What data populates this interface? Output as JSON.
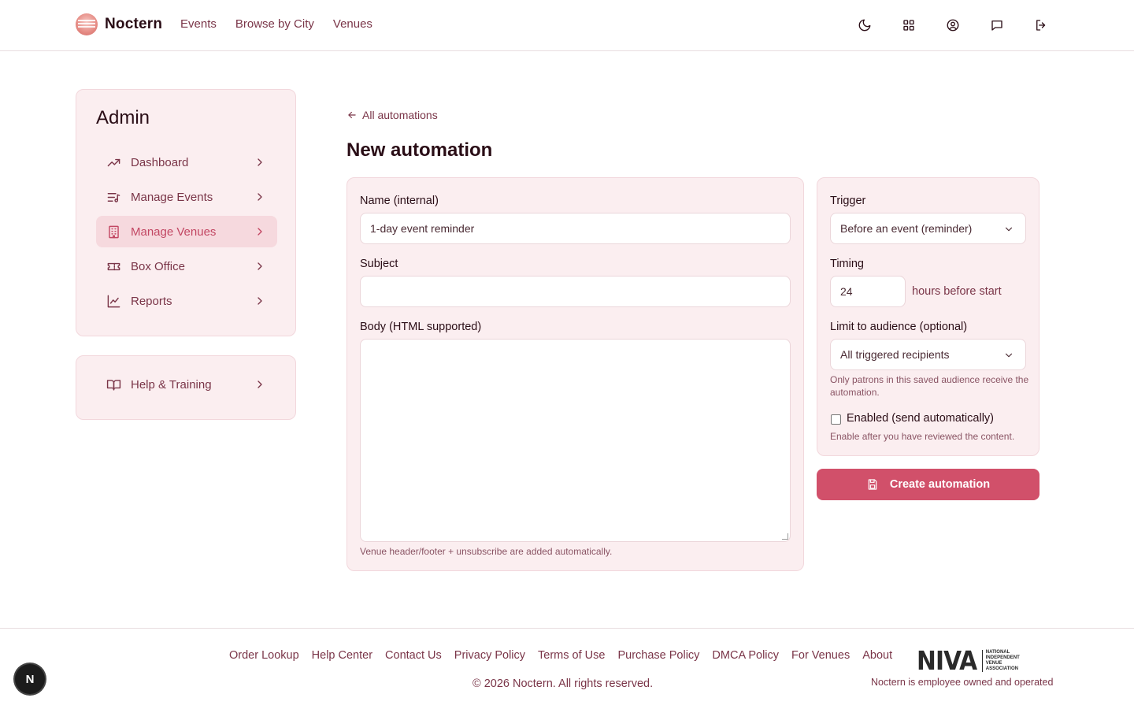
{
  "header": {
    "brand": "Noctern",
    "nav": [
      "Events",
      "Browse by City",
      "Venues"
    ],
    "icons": [
      "moon-icon",
      "grid-icon",
      "user-circle-icon",
      "message-icon",
      "logout-icon"
    ]
  },
  "sidebar": {
    "title": "Admin",
    "items": [
      {
        "label": "Dashboard",
        "icon": "trending-up-icon"
      },
      {
        "label": "Manage Events",
        "icon": "list-music-icon"
      },
      {
        "label": "Manage Venues",
        "icon": "building-icon",
        "active": true
      },
      {
        "label": "Box Office",
        "icon": "ticket-icon"
      },
      {
        "label": "Reports",
        "icon": "line-chart-icon"
      }
    ],
    "help": {
      "label": "Help & Training",
      "icon": "book-icon"
    }
  },
  "main": {
    "back_link": "All automations",
    "title": "New automation",
    "form": {
      "name_label": "Name (internal)",
      "name_value": "1-day event reminder",
      "subject_label": "Subject",
      "subject_value": "",
      "body_label": "Body (HTML supported)",
      "body_hint": "Venue header/footer + unsubscribe are added automatically."
    },
    "settings": {
      "trigger_label": "Trigger",
      "trigger_value": "Before an event (reminder)",
      "timing_label": "Timing",
      "timing_value": "24",
      "timing_suffix": "hours before start",
      "audience_label": "Limit to audience (optional)",
      "audience_value": "All triggered recipients",
      "audience_hint": "Only patrons in this saved audience receive the automation.",
      "enabled_label": "Enabled (send automatically)",
      "enabled_checked": false,
      "enabled_hint": "Enable after you have reviewed the content."
    },
    "create_button": "Create automation"
  },
  "footer": {
    "links": [
      "Order Lookup",
      "Help Center",
      "Contact Us",
      "Privacy Policy",
      "Terms of Use",
      "Purchase Policy",
      "DMCA Policy",
      "For Venues",
      "About"
    ],
    "copyright": "© 2026 Noctern. All rights reserved.",
    "niva_logo": "NIVA",
    "niva_lines": [
      "NATIONAL",
      "INDEPENDENT",
      "VENUE",
      "ASSOCIATION"
    ],
    "tagline": "Noctern is employee owned and operated"
  },
  "badge": "N",
  "colors": {
    "accent": "#d1506a",
    "panel": "#fbeef0",
    "text_muted": "#7a3548"
  }
}
